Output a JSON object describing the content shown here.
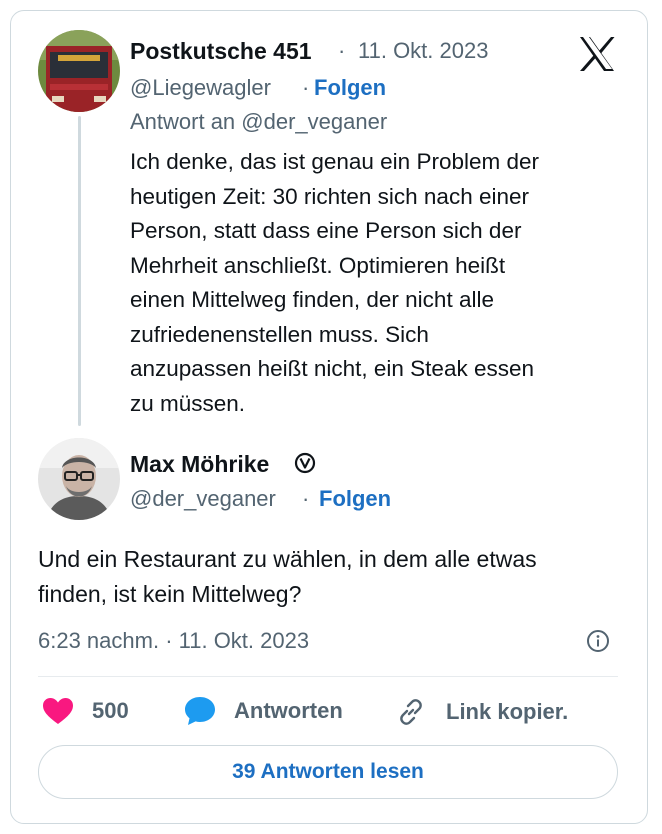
{
  "reply_tweet": {
    "author_name": "Postkutsche 451",
    "separator": "·",
    "date": "11. Okt. 2023",
    "handle": "@Liegewagler",
    "follow_label": "Folgen",
    "reply_to": "Antwort an @der_veganer",
    "text": "Ich denke, das ist genau ein Problem der\nheutigen Zeit: 30 richten sich nach einer\nPerson, statt dass eine Person sich der\nMehrheit anschließt. Optimieren heißt\neinen Mittelweg finden, der nicht alle\nzufriedenenstellen muss. Sich\nanzupassen heißt nicht, ein Steak essen\nzu müssen."
  },
  "main_tweet": {
    "author_name": "Max Möhrike",
    "handle": "@der_veganer",
    "follow_label": "Folgen",
    "text": "Und ein Restaurant zu wählen, in dem alle etwas\nfinden, ist kein Mittelweg?",
    "timestamp": "6:23 nachm. · 11. Okt. 2023"
  },
  "actions": {
    "likes": "500",
    "reply_label": "Antworten",
    "copy_link_label": "Link kopier."
  },
  "read_replies_label": "39 Antworten lesen",
  "icons": {
    "logo": "x-logo-icon",
    "verified": "vegan-badge-icon",
    "info": "info-icon",
    "like": "heart-icon",
    "reply": "speech-bubble-icon",
    "link": "link-icon"
  },
  "colors": {
    "link_blue": "#1d9bf0",
    "heart": "#f91880",
    "text": "#0f1419",
    "muted": "#536471"
  }
}
